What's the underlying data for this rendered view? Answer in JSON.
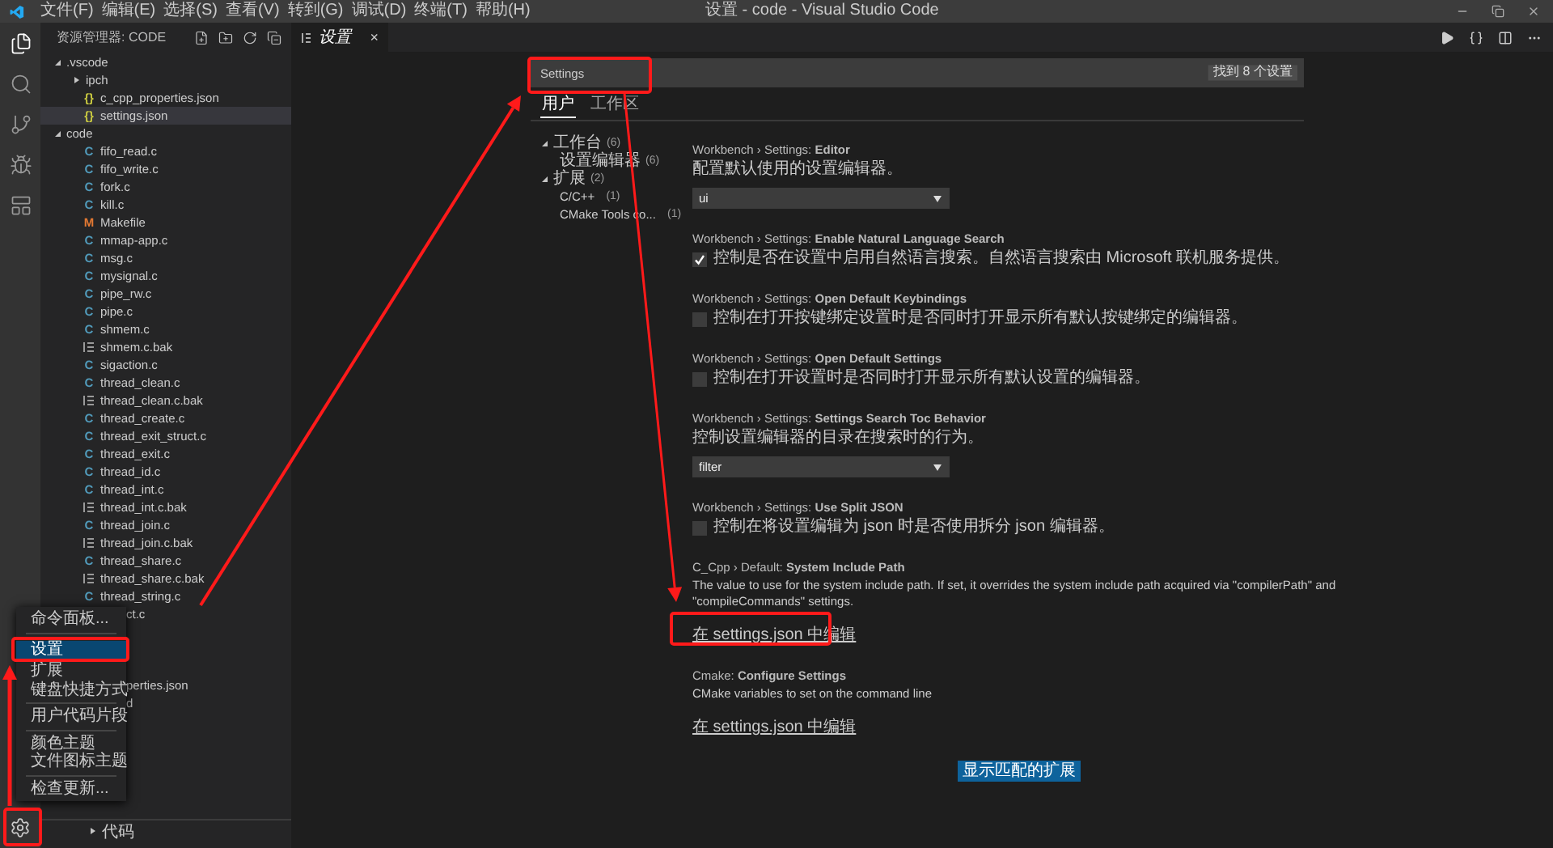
{
  "window": {
    "title": "设置 - code - Visual Studio Code"
  },
  "menu_bar": [
    "文件(F)",
    "编辑(E)",
    "选择(S)",
    "查看(V)",
    "转到(G)",
    "调试(D)",
    "终端(T)",
    "帮助(H)"
  ],
  "explorer": {
    "title": "资源管理器: CODE",
    "tree": [
      {
        "kind": "folder",
        "name": ".vscode",
        "expanded": true,
        "selected": false,
        "children": [
          {
            "kind": "folder",
            "name": "ipch",
            "expanded": false,
            "selected": false
          },
          {
            "kind": "json",
            "glyph": "{}",
            "name": "c_cpp_properties.json",
            "selected": false
          },
          {
            "kind": "json",
            "glyph": "{}",
            "name": "settings.json",
            "selected": true
          }
        ]
      },
      {
        "kind": "folder",
        "name": "code",
        "expanded": true,
        "selected": false,
        "children": [
          {
            "kind": "c",
            "glyph": "C",
            "name": "fifo_read.c",
            "selected": false
          },
          {
            "kind": "c",
            "glyph": "C",
            "name": "fifo_write.c",
            "selected": false
          },
          {
            "kind": "c",
            "glyph": "C",
            "name": "fork.c",
            "selected": false
          },
          {
            "kind": "c",
            "glyph": "C",
            "name": "kill.c",
            "selected": false
          },
          {
            "kind": "make",
            "glyph": "M",
            "name": "Makefile",
            "selected": false
          },
          {
            "kind": "c",
            "glyph": "C",
            "name": "mmap-app.c",
            "selected": false
          },
          {
            "kind": "c",
            "glyph": "C",
            "name": "msg.c",
            "selected": false
          },
          {
            "kind": "c",
            "glyph": "C",
            "name": "mysignal.c",
            "selected": false
          },
          {
            "kind": "c",
            "glyph": "C",
            "name": "pipe_rw.c",
            "selected": false
          },
          {
            "kind": "c",
            "glyph": "C",
            "name": "pipe.c",
            "selected": false
          },
          {
            "kind": "c",
            "glyph": "C",
            "name": "shmem.c",
            "selected": false
          },
          {
            "kind": "bak",
            "name": "shmem.c.bak",
            "selected": false
          },
          {
            "kind": "c",
            "glyph": "C",
            "name": "sigaction.c",
            "selected": false
          },
          {
            "kind": "c",
            "glyph": "C",
            "name": "thread_clean.c",
            "selected": false
          },
          {
            "kind": "bak",
            "name": "thread_clean.c.bak",
            "selected": false
          },
          {
            "kind": "c",
            "glyph": "C",
            "name": "thread_create.c",
            "selected": false
          },
          {
            "kind": "c",
            "glyph": "C",
            "name": "thread_exit_struct.c",
            "selected": false
          },
          {
            "kind": "c",
            "glyph": "C",
            "name": "thread_exit.c",
            "selected": false
          },
          {
            "kind": "c",
            "glyph": "C",
            "name": "thread_id.c",
            "selected": false
          },
          {
            "kind": "c",
            "glyph": "C",
            "name": "thread_int.c",
            "selected": false
          },
          {
            "kind": "bak",
            "name": "thread_int.c.bak",
            "selected": false
          },
          {
            "kind": "c",
            "glyph": "C",
            "name": "thread_join.c",
            "selected": false
          },
          {
            "kind": "bak",
            "name": "thread_join.c.bak",
            "selected": false
          },
          {
            "kind": "c",
            "glyph": "C",
            "name": "thread_share.c",
            "selected": false
          },
          {
            "kind": "bak",
            "name": "thread_share.c.bak",
            "selected": false
          },
          {
            "kind": "c",
            "glyph": "C",
            "name": "thread_string.c",
            "selected": false
          },
          {
            "kind": "partial",
            "name": "ct.c",
            "selected": false
          },
          {
            "kind": "hidden",
            "selected": false
          },
          {
            "kind": "hidden",
            "selected": false
          },
          {
            "kind": "hidden",
            "selected": false
          },
          {
            "kind": "partial",
            "name": "perties.json",
            "selected": false
          },
          {
            "kind": "partial",
            "name": "d",
            "selected": false
          }
        ]
      }
    ],
    "bottom_section": {
      "title": "代码",
      "expanded": false
    }
  },
  "editor_tab": {
    "title": "设置",
    "close": "×"
  },
  "settings": {
    "search": {
      "value": "Settings",
      "result": "找到 8 个设置"
    },
    "scopes": [
      {
        "label": "用户",
        "selected": true
      },
      {
        "label": "工作区",
        "selected": false
      }
    ],
    "toc": [
      {
        "label": "工作台",
        "count": "(6)",
        "expanded": true,
        "children": [
          {
            "label": "设置编辑器",
            "count": "(6)"
          }
        ]
      },
      {
        "label": "扩展",
        "count": "(2)",
        "expanded": true,
        "children": [
          {
            "label": "C/C++",
            "count": "(1)"
          },
          {
            "label": "CMake Tools co...",
            "count": "(1)"
          }
        ]
      }
    ],
    "items": [
      {
        "kind": "select",
        "title": "Workbench › Settings: **Editor**",
        "description": "配置默认使用的设置编辑器。",
        "value": "ui"
      },
      {
        "kind": "checkbox",
        "title": "Workbench › Settings: **Enable Natural Language Search**",
        "description": "控制是否在设置中启用自然语言搜索。自然语言搜索由 Microsoft 联机服务提供。",
        "checked": true
      },
      {
        "kind": "checkbox",
        "title": "Workbench › Settings: **Open Default Keybindings**",
        "description": "控制在打开按键绑定设置时是否同时打开显示所有默认按键绑定的编辑器。",
        "checked": false
      },
      {
        "kind": "checkbox",
        "title": "Workbench › Settings: **Open Default Settings**",
        "description": "控制在打开设置时是否同时打开显示所有默认设置的编辑器。",
        "checked": false
      },
      {
        "kind": "select",
        "title": "Workbench › Settings: **Settings Search Toc Behavior**",
        "description": "控制设置编辑器的目录在搜索时的行为。",
        "value": "filter"
      },
      {
        "kind": "checkbox",
        "title": "Workbench › Settings: **Use Split JSON**",
        "description": "控制在将设置编辑为 json 时是否使用拆分 json 编辑器。",
        "checked": false
      },
      {
        "kind": "link",
        "title": "C_Cpp › Default: **System Include Path**",
        "description": "The value to use for the system include path. If set, it overrides the system include path acquired via \"compilerPath\" and \"compileCommands\" settings.",
        "link": "在 settings.json 中编辑"
      },
      {
        "kind": "link",
        "title": "Cmake: **Configure Settings**",
        "description": "CMake variables to set on the command line",
        "link": "在 settings.json 中编辑"
      }
    ],
    "button": "显示匹配的扩展"
  },
  "manage_menu": [
    {
      "kind": "item",
      "label": "命令面板...",
      "selected": false
    },
    {
      "kind": "separator"
    },
    {
      "kind": "item",
      "label": "设置",
      "selected": true
    },
    {
      "kind": "item",
      "label": "扩展",
      "selected": false
    },
    {
      "kind": "item",
      "label": "键盘快捷方式",
      "selected": false
    },
    {
      "kind": "separator"
    },
    {
      "kind": "item",
      "label": "用户代码片段",
      "selected": false
    },
    {
      "kind": "separator"
    },
    {
      "kind": "item",
      "label": "颜色主题",
      "selected": false
    },
    {
      "kind": "item",
      "label": "文件图标主题",
      "selected": false
    },
    {
      "kind": "separator"
    },
    {
      "kind": "item",
      "label": "检查更新...",
      "selected": false
    }
  ]
}
